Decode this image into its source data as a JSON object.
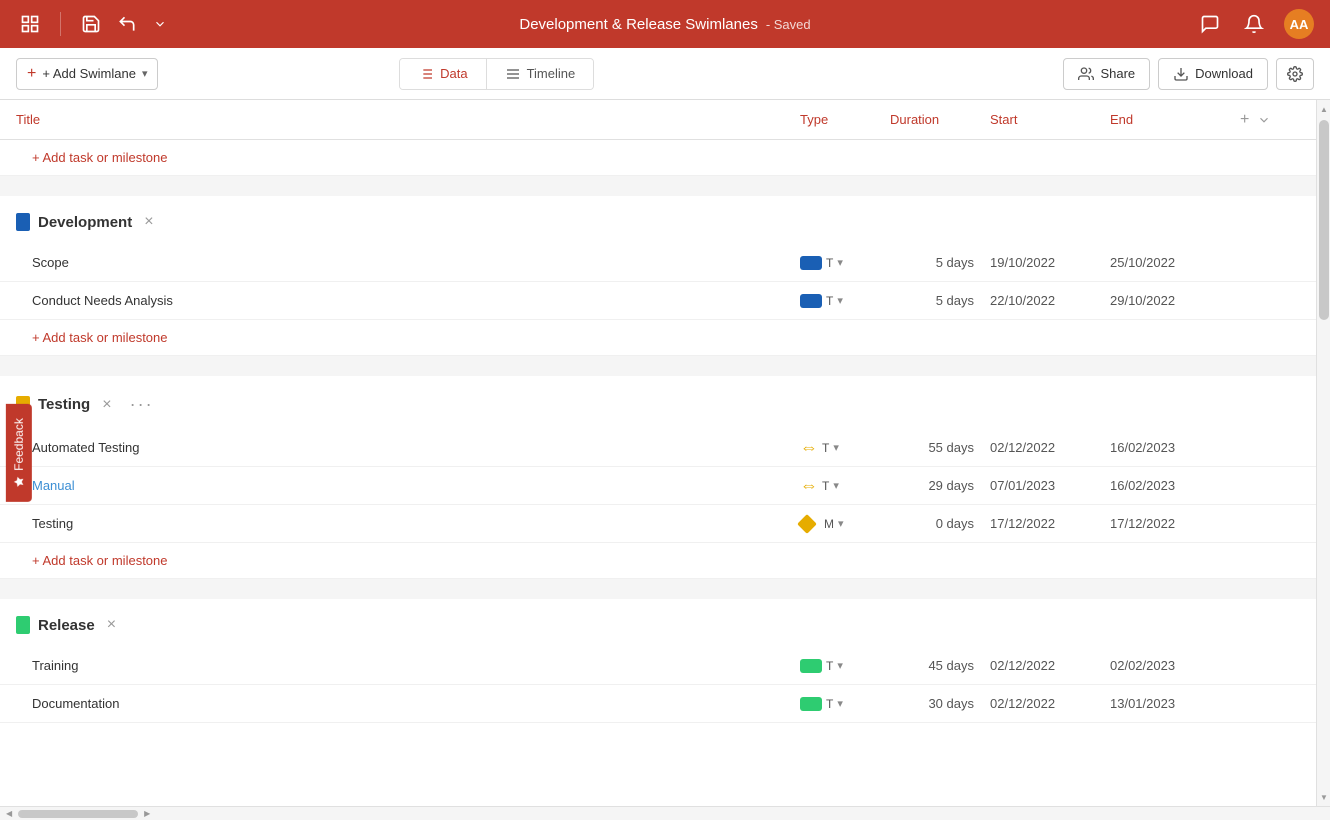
{
  "topbar": {
    "title": "Development & Release Swimlanes",
    "saved_label": "- Saved",
    "avatar_initials": "AA"
  },
  "toolbar": {
    "add_swimlane": "+ Add Swimlane",
    "tab_data": "Data",
    "tab_timeline": "Timeline",
    "share_label": "Share",
    "download_label": "Download"
  },
  "table": {
    "col_title": "Title",
    "col_type": "Type",
    "col_duration": "Duration",
    "col_start": "Start",
    "col_end": "End"
  },
  "sections": [
    {
      "id": "empty",
      "title": "",
      "color": null,
      "items": [],
      "show_header": false
    },
    {
      "id": "development",
      "title": "Development",
      "color": "#1a5fb4",
      "items": [
        {
          "title": "Scope",
          "type": "T",
          "type_color": "#1a5fb4",
          "duration": "5 days",
          "start": "19/10/2022",
          "end": "25/10/2022",
          "icon": "rect",
          "is_link": false
        },
        {
          "title": "Conduct Needs Analysis",
          "type": "T",
          "type_color": "#1a5fb4",
          "duration": "5 days",
          "start": "22/10/2022",
          "end": "29/10/2022",
          "icon": "rect",
          "is_link": false
        }
      ]
    },
    {
      "id": "testing",
      "title": "Testing",
      "color": "#e6ac00",
      "items": [
        {
          "title": "Automated Testing",
          "type": "T",
          "type_color": "#e6ac00",
          "duration": "55 days",
          "start": "02/12/2022",
          "end": "16/02/2023",
          "icon": "arrow",
          "is_link": false
        },
        {
          "title": "Manual",
          "type": "T",
          "type_color": "#e6ac00",
          "duration": "29 days",
          "start": "07/01/2023",
          "end": "16/02/2023",
          "icon": "arrow",
          "is_link": true
        },
        {
          "title": "Testing",
          "type": "M",
          "type_color": "#e6ac00",
          "duration": "0 days",
          "start": "17/12/2022",
          "end": "17/12/2022",
          "icon": "diamond",
          "is_link": false
        }
      ]
    },
    {
      "id": "release",
      "title": "Release",
      "color": "#2ecc71",
      "items": [
        {
          "title": "Training",
          "type": "T",
          "type_color": "#2ecc71",
          "duration": "45 days",
          "start": "02/12/2022",
          "end": "02/02/2023",
          "icon": "rect",
          "is_link": false
        },
        {
          "title": "Documentation",
          "type": "T",
          "type_color": "#2ecc71",
          "duration": "30 days",
          "start": "02/12/2022",
          "end": "13/01/2023",
          "icon": "rect",
          "is_link": false
        }
      ]
    }
  ],
  "add_task_label": "+ Add task or milestone",
  "feedback_label": "Feedback"
}
